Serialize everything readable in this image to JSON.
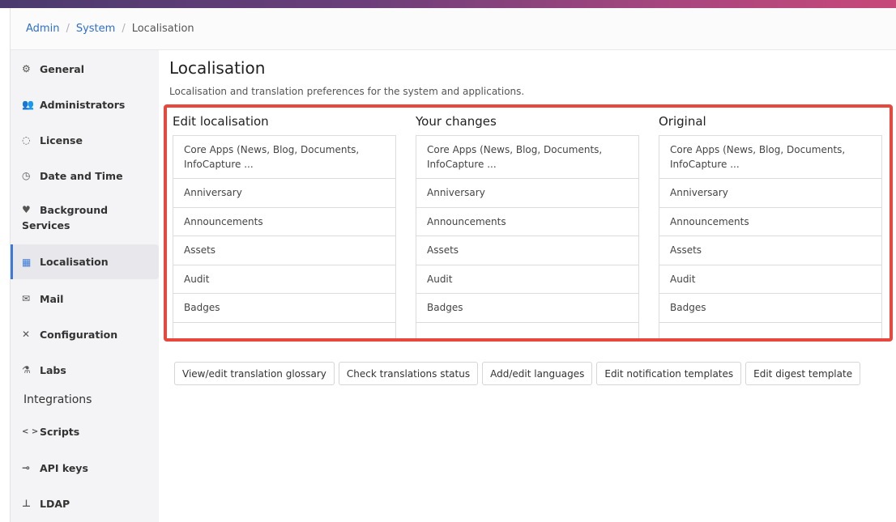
{
  "breadcrumb": {
    "items": [
      "Admin",
      "System"
    ],
    "current": "Localisation"
  },
  "sidebar": {
    "items": [
      {
        "label": "General",
        "icon": "gears-icon"
      },
      {
        "label": "Administrators",
        "icon": "users-icon"
      },
      {
        "label": "License",
        "icon": "license-icon"
      },
      {
        "label": "Date and Time",
        "icon": "clock-icon"
      },
      {
        "label": "Background",
        "label2": "Services",
        "icon": "heartbeat-icon"
      },
      {
        "label": "Localisation",
        "icon": "language-icon",
        "active": true
      },
      {
        "label": "Mail",
        "icon": "mail-icon"
      },
      {
        "label": "Configuration",
        "icon": "tools-icon"
      },
      {
        "label": "Labs",
        "icon": "flask-icon"
      }
    ],
    "section_title": "Integrations",
    "integrations": [
      {
        "label": "Scripts",
        "icon": "code-icon"
      },
      {
        "label": "API keys",
        "icon": "key-icon"
      },
      {
        "label": "LDAP",
        "icon": "sitemap-icon"
      }
    ]
  },
  "main": {
    "title": "Localisation",
    "subtitle": "Localisation and translation preferences for the system and applications.",
    "columns": [
      {
        "title": "Edit localisation"
      },
      {
        "title": "Your changes"
      },
      {
        "title": "Original"
      }
    ],
    "list_items": [
      {
        "line1": "Core Apps (News, Blog, Documents,",
        "line2": "InfoCapture ..."
      },
      {
        "line1": "Anniversary"
      },
      {
        "line1": "Announcements"
      },
      {
        "line1": "Assets"
      },
      {
        "line1": "Audit"
      },
      {
        "line1": "Badges"
      }
    ],
    "buttons": [
      "View/edit translation glossary",
      "Check translations status",
      "Add/edit languages",
      "Edit notification templates",
      "Edit digest template"
    ]
  },
  "colors": {
    "accent": "#3d7ad8",
    "highlight": "#e8473e",
    "link": "#2d6fd1"
  }
}
